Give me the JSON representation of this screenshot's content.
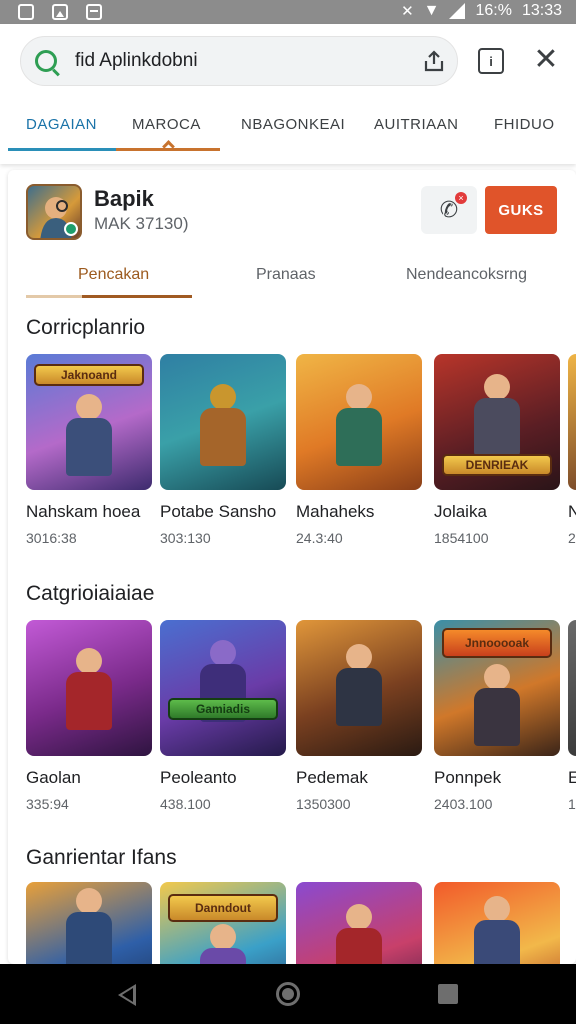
{
  "status_bar": {
    "battery": "16:%",
    "time": "13:33"
  },
  "search": {
    "text": "fid Aplinkdobni"
  },
  "top_tabs": [
    "DAGAIAN",
    "MAROCA",
    "NBAGONKEAI",
    "AUITRIAAN",
    "FHIDUO"
  ],
  "app": {
    "name": "Bapik",
    "meta": "MAK 37130)",
    "install_label": "GUKS"
  },
  "sub_tabs": [
    "Pencakan",
    "Pranaas",
    "Nendeancoksrng"
  ],
  "sections": [
    {
      "title": "Corricplanrio",
      "items": [
        {
          "name": "Nahskam hoea",
          "sub": "3016:38",
          "banner": "Jaknoand"
        },
        {
          "name": "Potabe Sansho",
          "sub": "303:130",
          "banner": ""
        },
        {
          "name": "Mahaheks",
          "sub": "24.3:40",
          "banner": ""
        },
        {
          "name": "Jolaika",
          "sub": "1854100",
          "banner": "DENRIEAK"
        },
        {
          "name": "N",
          "sub": "2",
          "banner": ""
        }
      ]
    },
    {
      "title": "Catgrioiaiaiae",
      "items": [
        {
          "name": "Gaolan",
          "sub": "335:94",
          "banner": ""
        },
        {
          "name": "Peoleanto",
          "sub": "438.100",
          "banner": "Gamiadis"
        },
        {
          "name": "Pedemak",
          "sub": "1350300",
          "banner": ""
        },
        {
          "name": "Ponnpek",
          "sub": "2403.100",
          "banner": "Jnnooooak"
        },
        {
          "name": "E",
          "sub": "1",
          "banner": ""
        }
      ]
    },
    {
      "title": "Ganrientar Ifans",
      "items": [
        {
          "name": "",
          "sub": "",
          "banner": ""
        },
        {
          "name": "",
          "sub": "",
          "banner": "Danndout"
        },
        {
          "name": "",
          "sub": "",
          "banner": ""
        },
        {
          "name": "",
          "sub": "",
          "banner": ""
        }
      ]
    }
  ],
  "colors": {
    "accent_blue": "#2a8fb8",
    "accent_orange": "#c8732e",
    "install_button": "#e0542a",
    "status_bar": "#8c8c8c",
    "nav_bar": "#000000"
  },
  "icons": [
    "search-icon",
    "share-icon",
    "info-icon",
    "close-icon",
    "phone-icon",
    "back-icon",
    "home-icon",
    "recent-apps-icon"
  ]
}
